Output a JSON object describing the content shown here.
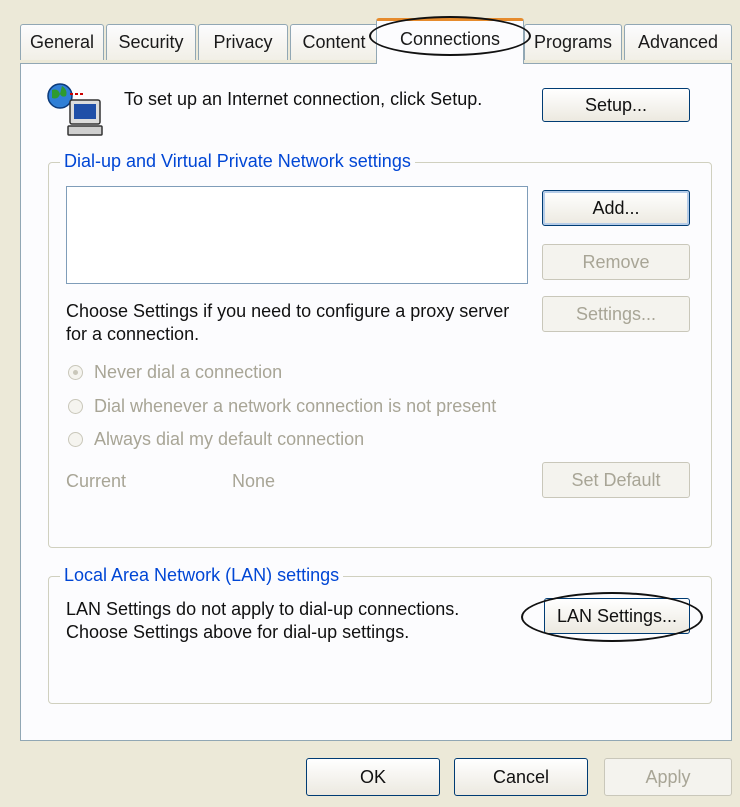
{
  "tabs": [
    {
      "label": "General"
    },
    {
      "label": "Security"
    },
    {
      "label": "Privacy"
    },
    {
      "label": "Content"
    },
    {
      "label": "Connections"
    },
    {
      "label": "Programs"
    },
    {
      "label": "Advanced"
    }
  ],
  "active_tab": "Connections",
  "setup": {
    "text": "To set up an Internet connection, click Setup.",
    "button": "Setup..."
  },
  "dialup": {
    "legend": "Dial-up and Virtual Private Network settings",
    "add_button": "Add...",
    "remove_button": "Remove",
    "proxy_text": "Choose Settings if you need to configure a proxy server for a connection.",
    "settings_button": "Settings...",
    "radio_options": [
      {
        "label": "Never dial a connection",
        "selected": true
      },
      {
        "label": "Dial whenever a network connection is not present",
        "selected": false
      },
      {
        "label": "Always dial my default connection",
        "selected": false
      }
    ],
    "current_label": "Current",
    "current_value": "None",
    "set_default_button": "Set Default"
  },
  "lan": {
    "legend": "Local Area Network (LAN) settings",
    "text": "LAN Settings do not apply to dial-up connections. Choose Settings above for dial-up settings.",
    "button": "LAN Settings..."
  },
  "footer": {
    "ok": "OK",
    "cancel": "Cancel",
    "apply": "Apply"
  },
  "colors": {
    "dialog_bg": "#ece9d8",
    "panel_bg": "#fcfcfe",
    "legend_blue": "#0046d5",
    "active_tab_accent": "#e68b2c",
    "disabled_text": "#a8a596"
  }
}
